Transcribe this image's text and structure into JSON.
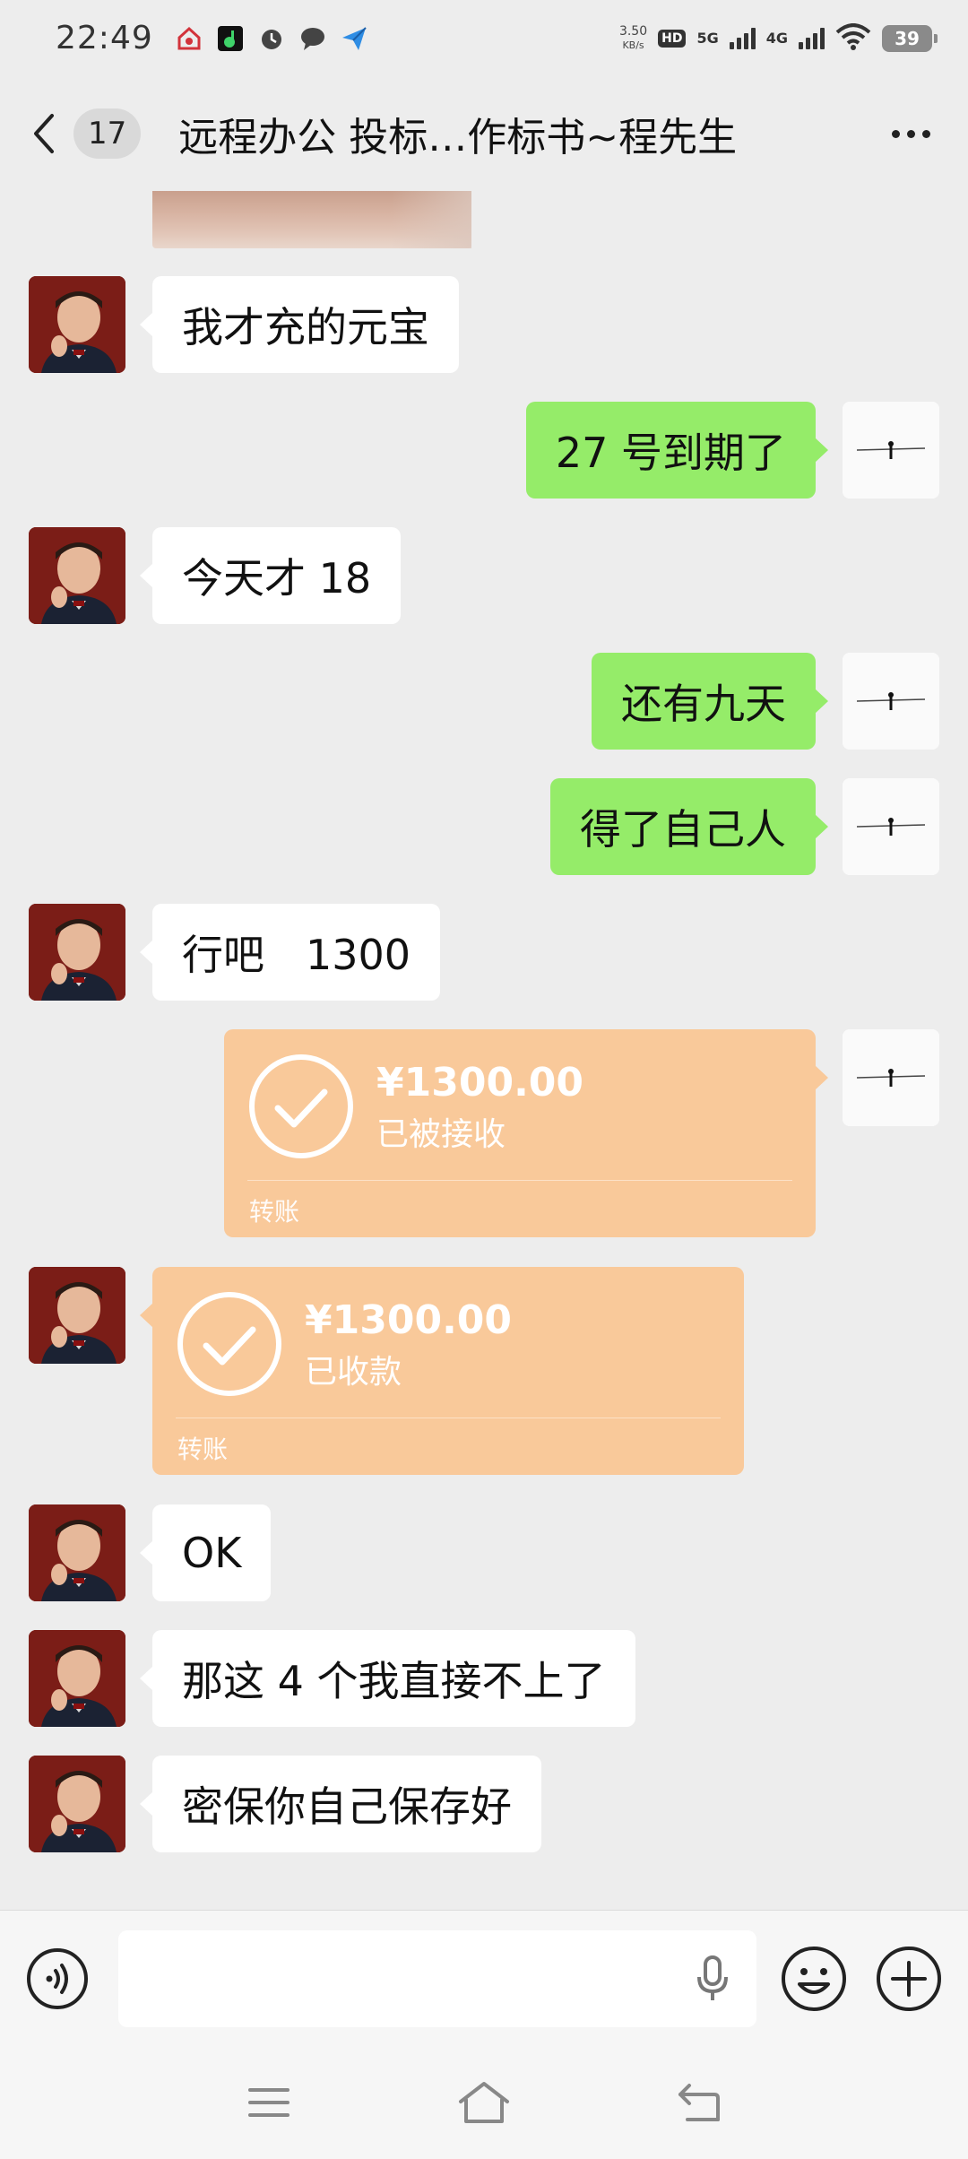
{
  "status_bar": {
    "time": "22:49",
    "network_speed_value": "3.50",
    "network_speed_unit": "KB/s",
    "hd_label": "HD",
    "signal_1_label": "5G",
    "signal_2_label": "4G",
    "battery": "39",
    "notification_icons": [
      "home-app-icon",
      "music-app-icon",
      "alarm-icon",
      "chat-bubble-icon",
      "send-icon"
    ]
  },
  "header": {
    "back_icon": "chevron-left-icon",
    "unread_count": "17",
    "title": "远程办公 投标…作标书~程先生",
    "more_icon": "more-dots-icon"
  },
  "messages": [
    {
      "type": "image",
      "direction": "in"
    },
    {
      "type": "text",
      "direction": "in",
      "text": "我才充的元宝"
    },
    {
      "type": "text",
      "direction": "out",
      "text": "27 号到期了"
    },
    {
      "type": "text",
      "direction": "in",
      "text": "今天才 18"
    },
    {
      "type": "text",
      "direction": "out",
      "text": "还有九天"
    },
    {
      "type": "text",
      "direction": "out",
      "text": "得了自己人"
    },
    {
      "type": "text",
      "direction": "in",
      "text": "行吧　1300"
    },
    {
      "type": "transfer",
      "direction": "out",
      "amount": "¥1300.00",
      "status": "已被接收",
      "label": "转账"
    },
    {
      "type": "transfer",
      "direction": "in",
      "amount": "¥1300.00",
      "status": "已收款",
      "label": "转账"
    },
    {
      "type": "text",
      "direction": "in",
      "text": "OK"
    },
    {
      "type": "text",
      "direction": "in",
      "text": "那这 4 个我直接不上了"
    },
    {
      "type": "text",
      "direction": "in",
      "text": "密保你自己保存好"
    }
  ],
  "input_bar": {
    "voice_icon": "voice-mode-icon",
    "input_value": "",
    "mic_icon": "microphone-icon",
    "emoji_icon": "emoji-icon",
    "plus_icon": "plus-icon"
  },
  "nav_bar": {
    "icons": [
      "menu-icon",
      "home-icon",
      "back-icon"
    ]
  },
  "colors": {
    "background": "#ededed",
    "outgoing_bubble": "#95ec69",
    "incoming_bubble": "#ffffff",
    "transfer_card": "#f9c99a"
  }
}
